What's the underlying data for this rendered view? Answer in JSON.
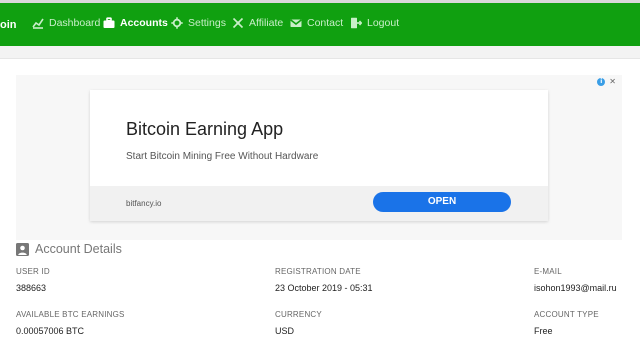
{
  "nav": {
    "brand": "oin",
    "items": [
      {
        "label": "Dashboard",
        "icon": "chart-icon"
      },
      {
        "label": "Accounts",
        "icon": "briefcase-icon"
      },
      {
        "label": "Settings",
        "icon": "gear-icon"
      },
      {
        "label": "Affiliate",
        "icon": "network-icon"
      },
      {
        "label": "Contact",
        "icon": "envelope-icon"
      },
      {
        "label": "Logout",
        "icon": "logout-icon"
      }
    ],
    "active": "Accounts"
  },
  "ad": {
    "title": "Bitcoin Earning App",
    "subtitle": "Start Bitcoin Mining Free Without Hardware",
    "domain": "bitfancy.io",
    "cta": "OPEN",
    "info_glyph": "i",
    "close_glyph": "✕"
  },
  "account": {
    "heading": "Account Details",
    "fields": [
      {
        "label": "USER ID",
        "value": "388663"
      },
      {
        "label": "REGISTRATION DATE",
        "value": "23 October 2019 - 05:31"
      },
      {
        "label": "E-MAIL",
        "value": "isohon1993@mail.ru"
      },
      {
        "label": "AVAILABLE BTC EARNINGS",
        "value": "0.00057006 BTC"
      },
      {
        "label": "CURRENCY",
        "value": "USD"
      },
      {
        "label": "ACCOUNT TYPE",
        "value": "Free"
      }
    ]
  },
  "colors": {
    "nav_bg": "#10a010",
    "cta_bg": "#1a73e8"
  }
}
